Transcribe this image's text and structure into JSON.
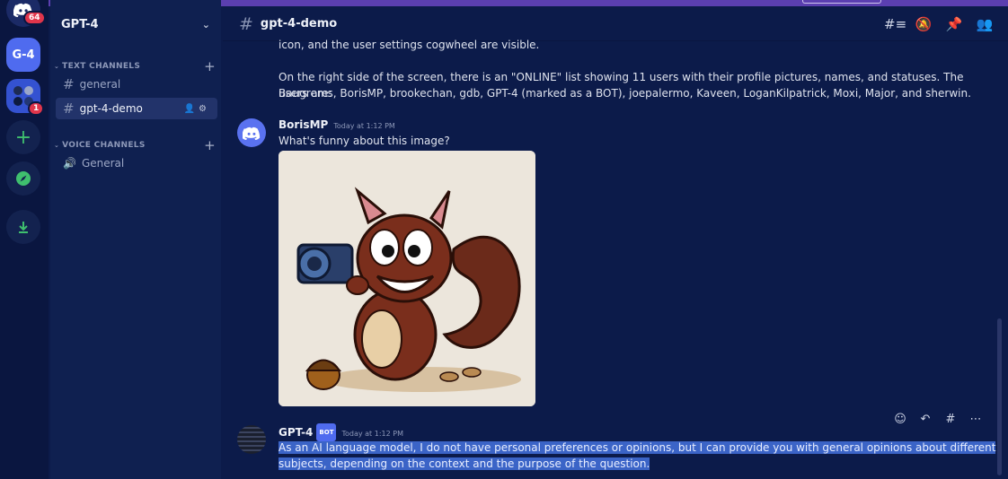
{
  "server_rail": {
    "home_badge": "64",
    "g4_label": "G-4",
    "group_badge": "1"
  },
  "sidebar": {
    "guild_name": "GPT-4",
    "text_category": "TEXT CHANNELS",
    "voice_category": "VOICE CHANNELS",
    "channels": [
      {
        "label": "general"
      },
      {
        "label": "gpt-4-demo"
      }
    ],
    "voice_channels": [
      {
        "label": "General"
      }
    ]
  },
  "header": {
    "channel_name": "gpt-4-demo"
  },
  "messages": {
    "prev_line": "icon, and the user settings cogwheel are visible.",
    "prev_para_1": "On the right side of the screen, there is an \"ONLINE\" list showing 11 users with their profile pictures, names, and statuses. The users are:",
    "prev_para_2": "Baugrems, BorisMP, brookechan, gdb, GPT-4 (marked as a BOT), joepalermo, Kaveen, LoganKilpatrick, Moxi, Major, and sherwin.",
    "boris": {
      "author": "BorisMP",
      "timestamp": "Today at 1:12 PM",
      "text": "What's funny about this image?"
    },
    "gpt": {
      "author": "GPT-4",
      "bot_tag": "BOT",
      "timestamp": "Today at 1:12 PM",
      "line1": "As an AI language model, I do not have personal preferences or opinions, but I can provide you with general opinions about different",
      "line2": "subjects, depending on the context and the purpose of the question."
    }
  },
  "colors": {
    "background": "#0c1b4a",
    "sidebar": "#0f2050",
    "accent": "#4f6bef",
    "selection": "#3b64c7",
    "badge": "#e0354b"
  }
}
